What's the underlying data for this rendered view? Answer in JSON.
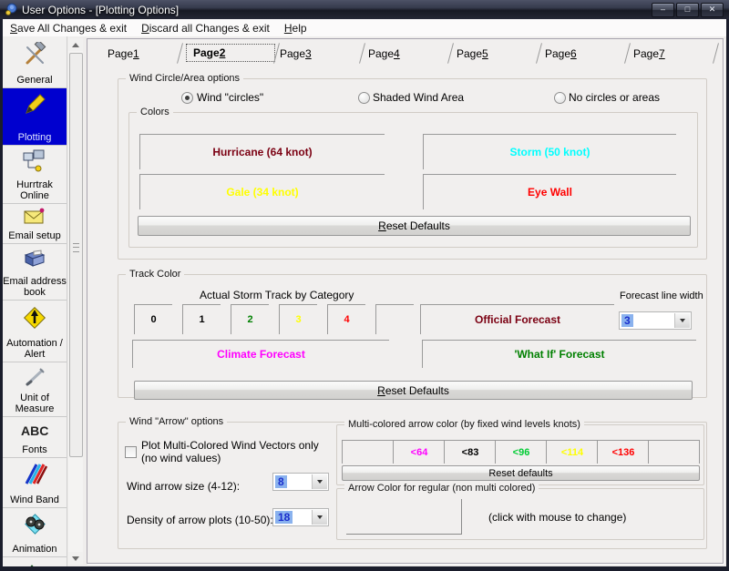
{
  "window": {
    "title": "User Options - [Plotting Options]",
    "controls": {
      "minimize": "–",
      "maximize": "□",
      "close": "✕"
    }
  },
  "menu": {
    "items": [
      {
        "accel": "S",
        "rest": "ave All Changes & exit"
      },
      {
        "accel": "D",
        "rest": "iscard all Changes & exit"
      },
      {
        "accel": "H",
        "rest": "elp"
      }
    ]
  },
  "sidebar": {
    "items": [
      {
        "label": "General",
        "icon": "tools-icon"
      },
      {
        "label": "Plotting",
        "icon": "pencil-icon",
        "selected": true
      },
      {
        "label": "Hurrtrak Online",
        "icon": "network-computers-icon"
      },
      {
        "label": "Email setup",
        "icon": "envelope-icon"
      },
      {
        "label": "Email address book",
        "icon": "address-book-icon"
      },
      {
        "label": "Automation / Alert",
        "icon": "alert-sign-icon"
      },
      {
        "label": "Unit of Measure",
        "icon": "pen-icon"
      },
      {
        "label": "Fonts",
        "icon": "fonts-abc-icon",
        "icon_text": "ABC"
      },
      {
        "label": "Wind Band",
        "icon": "wind-band-stripes-icon"
      },
      {
        "label": "Animation",
        "icon": "film-reels-icon"
      },
      {
        "label": "",
        "icon": "map-icon"
      }
    ]
  },
  "tabs": [
    {
      "pre": "Page ",
      "accel": "1"
    },
    {
      "pre": "Page ",
      "accel": "2",
      "selected": true
    },
    {
      "pre": "Page ",
      "accel": "3"
    },
    {
      "pre": "Page ",
      "accel": "4"
    },
    {
      "pre": "Page ",
      "accel": "5"
    },
    {
      "pre": "Page ",
      "accel": "6"
    },
    {
      "pre": "Page ",
      "accel": "7"
    }
  ],
  "wind_circle": {
    "title": "Wind Circle/Area options",
    "radios": [
      {
        "label": "Wind \"circles\"",
        "selected": true
      },
      {
        "label": "Shaded Wind Area",
        "selected": false
      },
      {
        "label": "No circles or areas",
        "selected": false
      }
    ],
    "colors": {
      "title": "Colors",
      "buttons": [
        {
          "label": "Hurricane (64 knot)",
          "color": "#7b0012"
        },
        {
          "label": "Storm (50 knot)",
          "color": "#00ffff"
        },
        {
          "label": "Gale (34 knot)",
          "color": "#ffff00"
        },
        {
          "label": "Eye Wall",
          "color": "#ff0000"
        }
      ],
      "reset": {
        "accel": "R",
        "rest": "eset Defaults"
      }
    }
  },
  "track_color": {
    "title": "Track Color",
    "category_label": "Actual Storm Track by Category",
    "categories": [
      {
        "label": "0",
        "color": "#000000"
      },
      {
        "label": "1",
        "color": "#000000"
      },
      {
        "label": "2",
        "color": "#008000"
      },
      {
        "label": "3",
        "color": "#ffff00"
      },
      {
        "label": "4",
        "color": "#ff0000"
      },
      {
        "label": "",
        "color": "#000000"
      }
    ],
    "official_forecast": {
      "label": "Official Forecast",
      "color": "#7b0012"
    },
    "climate_forecast": {
      "label": "Climate Forecast",
      "color": "#ff00ff"
    },
    "whatif_forecast": {
      "label": "'What If' Forecast",
      "color": "#008000"
    },
    "line_width": {
      "label": "Forecast line width",
      "value": "3"
    },
    "reset": {
      "accel": "R",
      "rest": "eset Defaults"
    }
  },
  "wind_arrow": {
    "title": "Wind \"Arrow\" options",
    "checkbox": {
      "label": "Plot Multi-Colored Wind Vectors only (no wind values)",
      "checked": false
    },
    "arrow_size": {
      "label": "Wind arrow size (4-12):",
      "value": "8"
    },
    "density": {
      "label": "Density of arrow plots (10-50):",
      "value": "18"
    },
    "multi": {
      "title": "Multi-colored arrow color (by fixed wind levels knots)",
      "levels": [
        {
          "label": "",
          "color": "#000000"
        },
        {
          "label": "<64",
          "color": "#ff00ff"
        },
        {
          "label": "<83",
          "color": "#000000"
        },
        {
          "label": "<96",
          "color": "#00cc33"
        },
        {
          "label": "<114",
          "color": "#ffff00"
        },
        {
          "label": "<136",
          "color": "#ff0000"
        },
        {
          "label": "",
          "color": "#000000"
        }
      ],
      "reset_label": "Reset defaults"
    },
    "regular": {
      "title": "Arrow Color for regular (non multi colored)",
      "hint": "(click with mouse to change)"
    }
  }
}
